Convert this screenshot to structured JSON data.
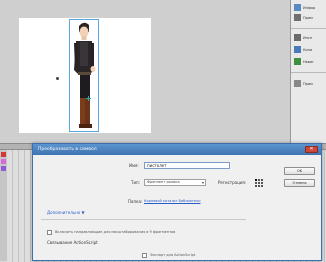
{
  "right_panel": {
    "items": [
      {
        "label": "Инфор"
      },
      {
        "label": "Прим"
      },
      {
        "label": "Инсп"
      },
      {
        "label": "Копи"
      },
      {
        "label": "Навиг"
      },
      {
        "label": "Прим"
      }
    ]
  },
  "dialog": {
    "title": "Преобразовать в символ",
    "close_glyph": "✕",
    "name_label": "Имя:",
    "name_value": "пистолет",
    "type_label": "Тип:",
    "type_value": "Фрагмент ролика",
    "registration_label": "Регистрация:",
    "folder_label": "Папка:",
    "folder_link": "Корневой каталог библиотеки",
    "advanced_toggle": "Дополнительно ▼",
    "guides_checkbox_label": "Включить направляющие для масштабирования в 9 фрагментов",
    "actionscript_header": "Связывание ActionScript",
    "export_checkbox_label": "Экспорт для ActionScript",
    "ok_button": "OK",
    "cancel_button": "Отмена"
  },
  "colors": {
    "title_bar": "#3f73b0",
    "link": "#2a5ec8",
    "selection_box": "#58a8e0",
    "layer_red": "#d23a3a",
    "layer_pink": "#d86bd8",
    "layer_purple": "#8d5ad8"
  }
}
